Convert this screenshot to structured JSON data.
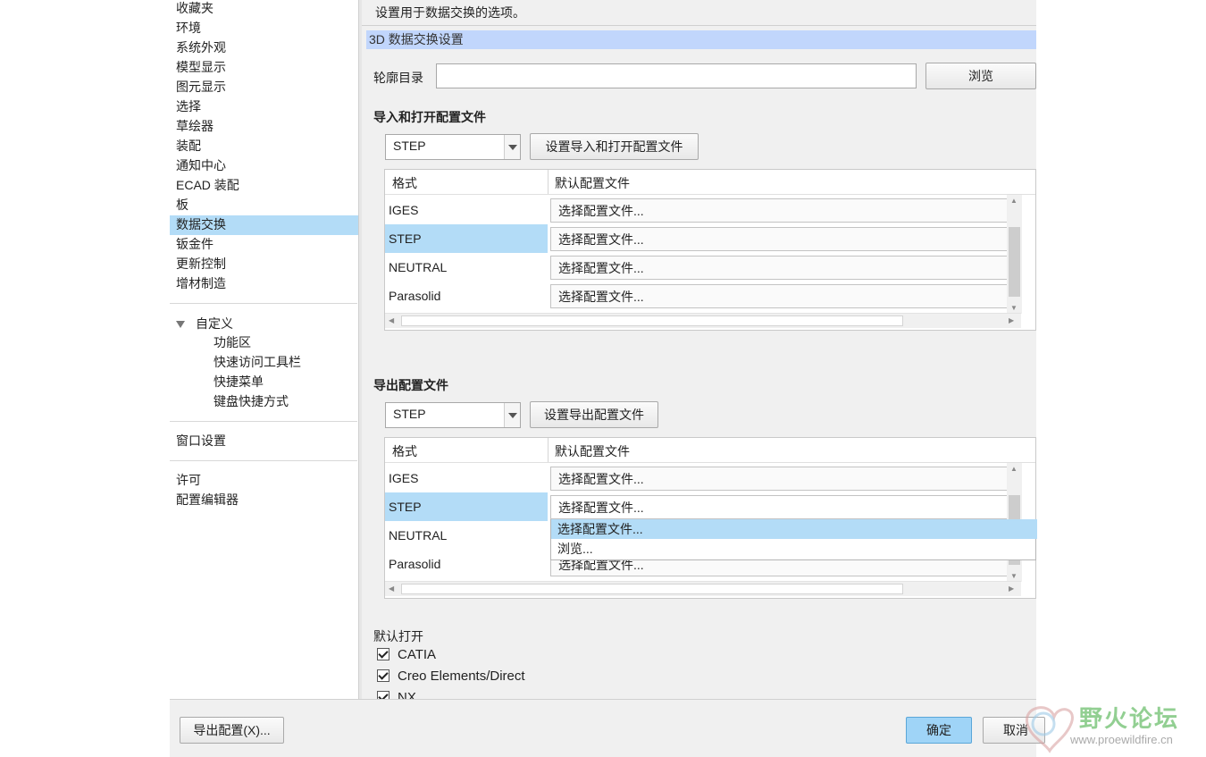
{
  "sidebar": {
    "items": [
      "收藏夹",
      "环境",
      "系统外观",
      "模型显示",
      "图元显示",
      "选择",
      "草绘器",
      "装配",
      "通知中心",
      "ECAD 装配",
      "板",
      "数据交换",
      "钣金件",
      "更新控制",
      "增材制造"
    ],
    "selected": "数据交换",
    "customize": {
      "label": "自定义",
      "children": [
        "功能区",
        "快速访问工具栏",
        "快捷菜单",
        "键盘快捷方式"
      ]
    },
    "window_settings": "窗口设置",
    "license": "许可",
    "config_editor": "配置编辑器"
  },
  "content": {
    "description": "设置用于数据交换的选项。",
    "banner": "3D 数据交换设置",
    "profile_dir": {
      "label": "轮廓目录",
      "value": "",
      "browse": "浏览"
    },
    "import_section": {
      "title": "导入和打开配置文件",
      "combo_value": "STEP",
      "set_button": "设置导入和打开配置文件",
      "headers": {
        "format": "格式",
        "default": "默认配置文件"
      },
      "rows": [
        {
          "format": "IGES",
          "value": "选择配置文件..."
        },
        {
          "format": "STEP",
          "value": "选择配置文件..."
        },
        {
          "format": "NEUTRAL",
          "value": "选择配置文件..."
        },
        {
          "format": "Parasolid",
          "value": "选择配置文件..."
        }
      ],
      "selected_row": "STEP"
    },
    "export_section": {
      "title": "导出配置文件",
      "combo_value": "STEP",
      "set_button": "设置导出配置文件",
      "headers": {
        "format": "格式",
        "default": "默认配置文件"
      },
      "rows": [
        {
          "format": "IGES",
          "value": "选择配置文件..."
        },
        {
          "format": "STEP",
          "value": "选择配置文件..."
        },
        {
          "format": "NEUTRAL",
          "value": ""
        },
        {
          "format": "Parasolid",
          "value": "选择配置文件..."
        }
      ],
      "selected_row": "STEP",
      "dropdown_options": [
        "选择配置文件...",
        "浏览..."
      ],
      "dropdown_highlighted": "选择配置文件..."
    },
    "default_open": {
      "title": "默认打开",
      "items": [
        {
          "label": "CATIA",
          "checked": true
        },
        {
          "label": "Creo Elements/Direct",
          "checked": true
        },
        {
          "label": "NX",
          "checked": true
        }
      ]
    }
  },
  "footer": {
    "export_config": "导出配置(X)...",
    "ok": "确定",
    "cancel": "取消"
  },
  "watermark": {
    "title": "野火论坛",
    "url": "www.proewildfire.cn"
  },
  "colors": {
    "selection": "#b3dcf7",
    "banner": "#c1d6fc",
    "ok_button": "#9fd4f7",
    "watermark": "#7fc77f"
  }
}
